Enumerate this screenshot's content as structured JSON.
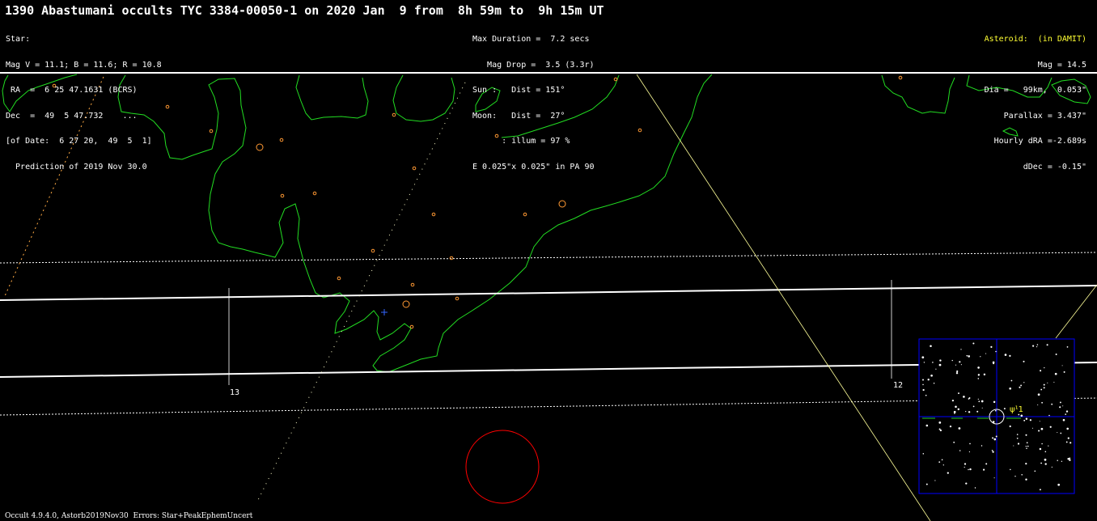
{
  "title": "1390 Abastumani occults TYC 3384-00050-1 on 2020 Jan  9 from  8h 59m to  9h 15m UT",
  "star": {
    "lines": [
      "Star:",
      "Mag V = 11.1; B = 11.6; R = 10.8",
      " RA  =  6 25 47.1631 (BCRS)",
      "Dec  =  49  5 47.732    ...",
      "[of Date:  6 27 20,  49  5  1]",
      "  Prediction of 2019 Nov 30.0"
    ]
  },
  "event": {
    "lines": [
      "Max Duration =  7.2 secs",
      "   Mag Drop =  3.5 (3.3r)",
      "Sun :   Dist = 151°",
      "Moon:   Dist =  27°",
      "      : illum = 97 %",
      "E 0.025\"x 0.025\" in PA 90"
    ]
  },
  "asteroid": {
    "header": "Asteroid:  (in DAMIT)",
    "lines": [
      "Mag = 14.5",
      "Dia =   99km,  0.053\"",
      "Parallax = 3.437\"",
      "Hourly dRA =-2.689s",
      "dDec = -0.15\""
    ]
  },
  "time_labels": {
    "left": "13",
    "right": "12"
  },
  "inset_label": "ψ¹1",
  "footer": "Occult 4.9.4.0, Astorb2019Nov30  Errors: Star+PeakEphemUncert",
  "colors": {
    "background": "#000000",
    "coastline": "#22dd22",
    "path_lines": "#ffffff",
    "sites": "#ff9933",
    "center_line": "#ffff99",
    "moon_circle": "#ff0000",
    "inset_border": "#0000ff",
    "asteroid_header": "#ffff33",
    "observer_marker": "#3366ff"
  }
}
